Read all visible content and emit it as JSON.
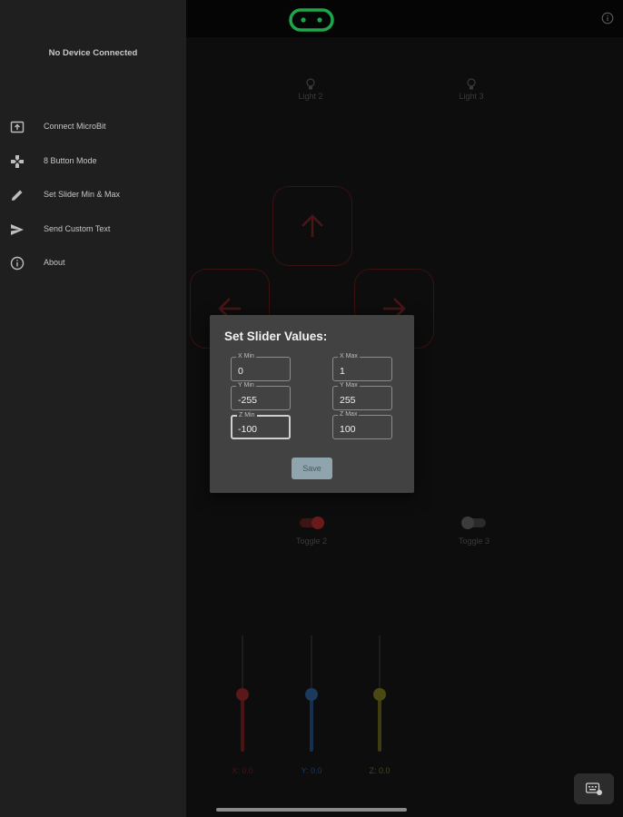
{
  "drawer": {
    "status": "No Device Connected",
    "items": [
      {
        "label": "Connect MicroBit",
        "icon": "connect-microbit-icon"
      },
      {
        "label": "8 Button Mode",
        "icon": "dpad-icon"
      },
      {
        "label": "Set Slider Min & Max",
        "icon": "pencil-icon"
      },
      {
        "label": "Send Custom Text",
        "icon": "send-icon"
      },
      {
        "label": "About",
        "icon": "info-icon"
      }
    ]
  },
  "main": {
    "lights": [
      {
        "label": "Light 2",
        "icon": "bulb-icon"
      },
      {
        "label": "Light 3",
        "icon": "bulb-icon"
      }
    ],
    "toggles": [
      {
        "label": "Toggle 2",
        "on": true
      },
      {
        "label": "Toggle 3",
        "on": false
      }
    ],
    "sliders": [
      {
        "label": "X: 0.0",
        "value": 0.0,
        "color": "#c62828"
      },
      {
        "label": "Y: 0.0",
        "value": 0.0,
        "color": "#1565c0"
      },
      {
        "label": "Z: 0.0",
        "value": 0.0,
        "color": "#9e9d24"
      }
    ]
  },
  "dialog": {
    "title": "Set Slider Values:",
    "fields": {
      "x_min": {
        "label": "X Min",
        "value": "0"
      },
      "x_max": {
        "label": "X Max",
        "value": "1"
      },
      "y_min": {
        "label": "Y Min",
        "value": "-255"
      },
      "y_max": {
        "label": "Y Max",
        "value": "255"
      },
      "z_min": {
        "label": "Z Min",
        "value": "-100"
      },
      "z_max": {
        "label": "Z Max",
        "value": "100"
      }
    },
    "save_label": "Save"
  },
  "colors": {
    "accent_green": "#1fa64a",
    "toggle_on": "#c62828",
    "save_button": "#90a4ae"
  }
}
